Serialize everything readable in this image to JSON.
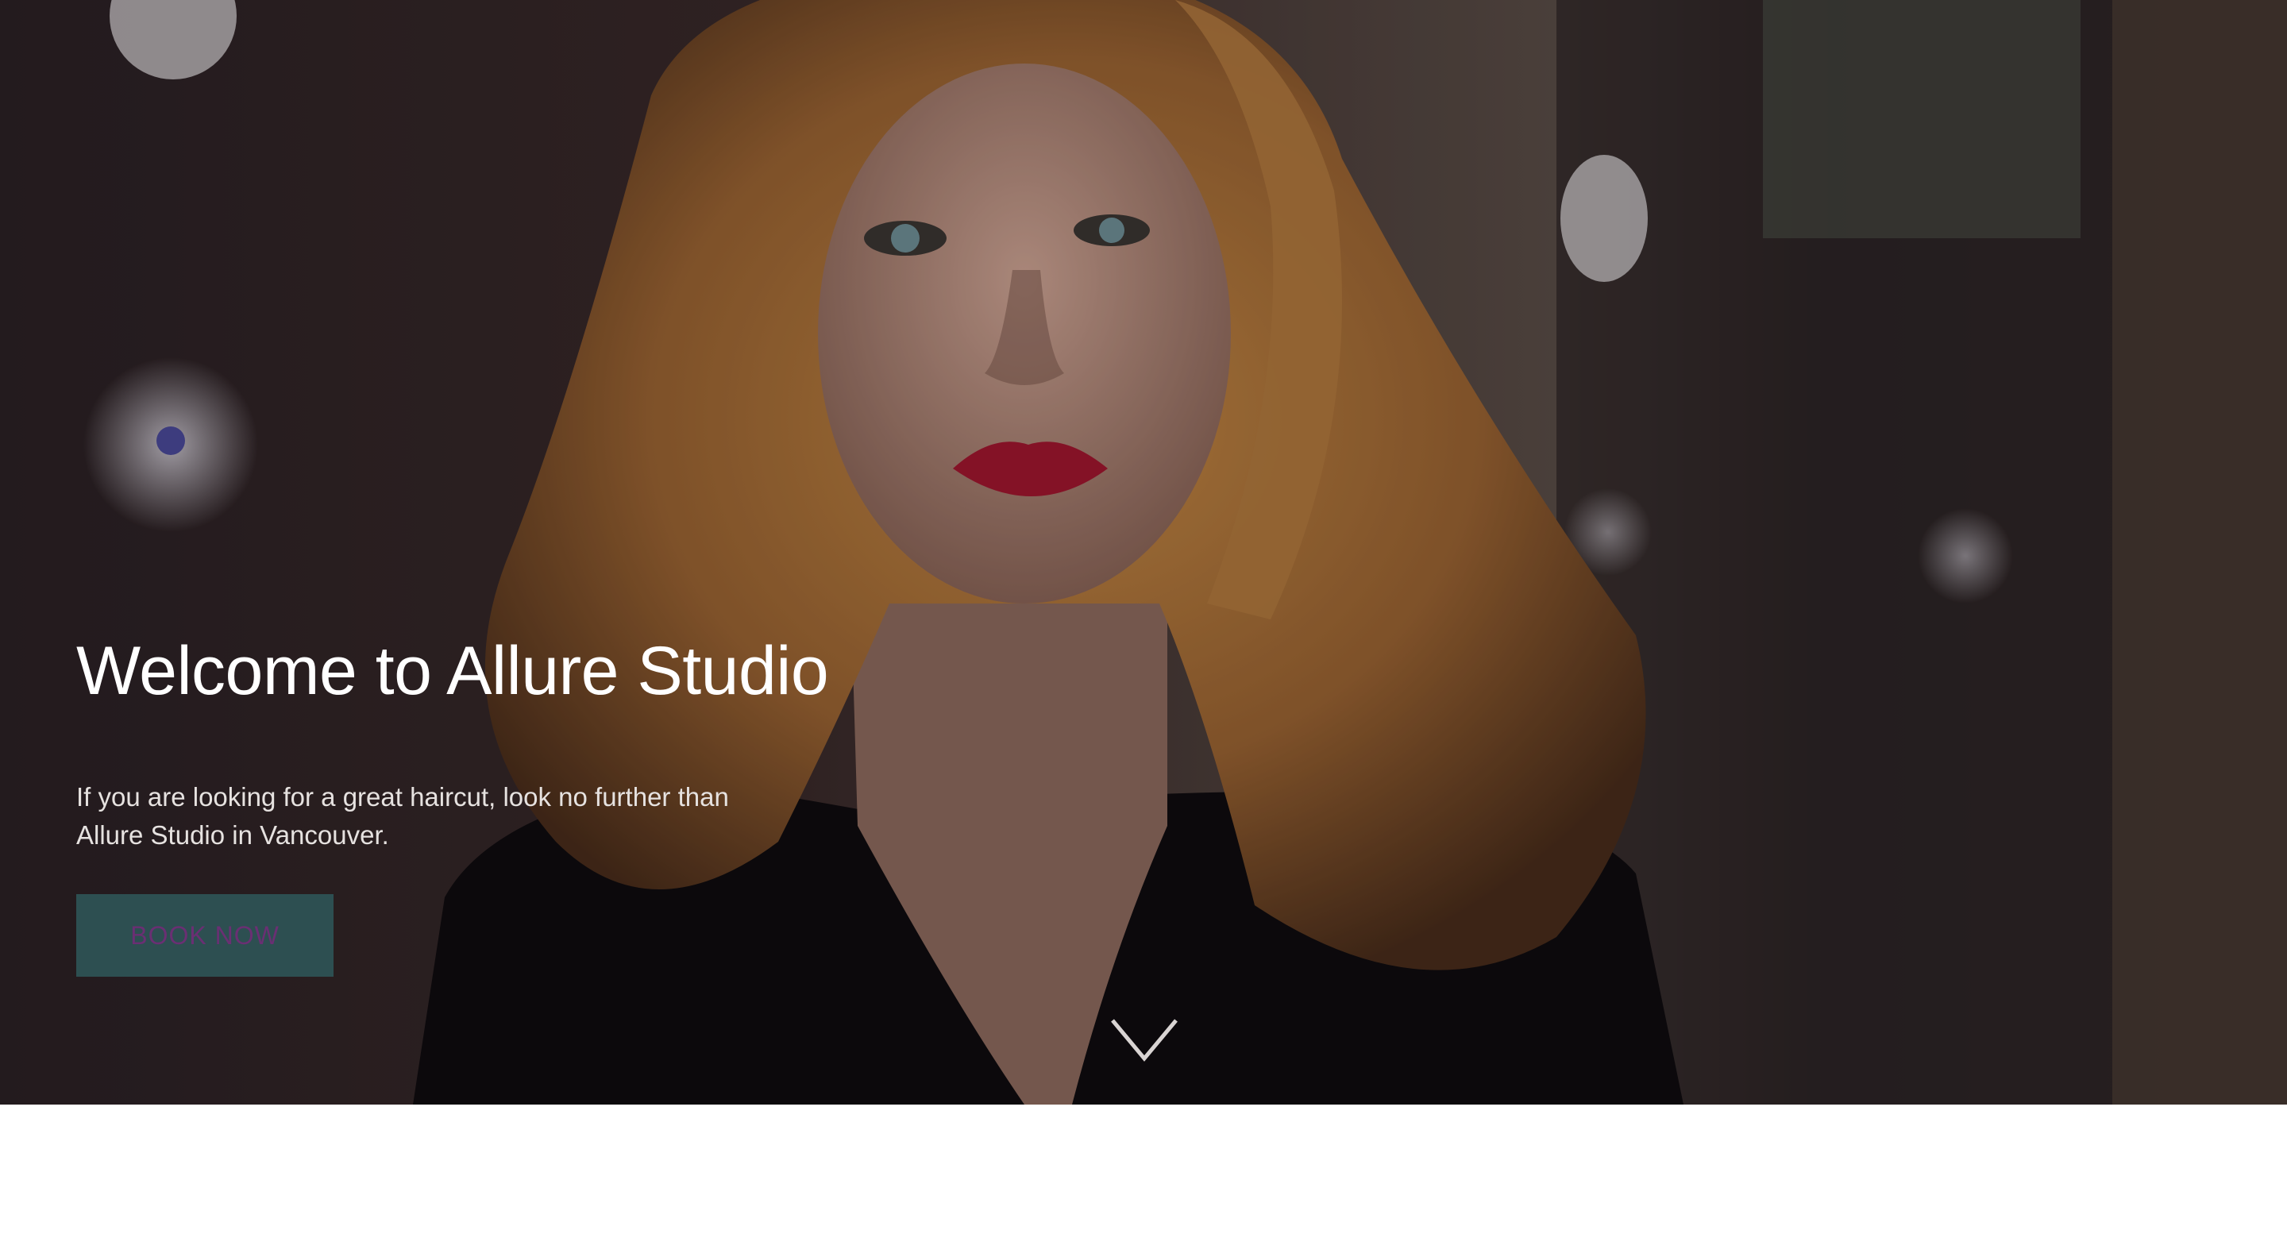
{
  "hero": {
    "title": "Welcome to Allure Studio",
    "description": "If you are looking for a great haircut, look no further than Allure Studio in Vancouver.",
    "cta_label": "BOOK NOW",
    "scroll_icon": "chevron-down-icon"
  },
  "colors": {
    "button_bg": "#2d4f51",
    "button_text": "#6a2f73",
    "title_text": "#ffffff"
  }
}
